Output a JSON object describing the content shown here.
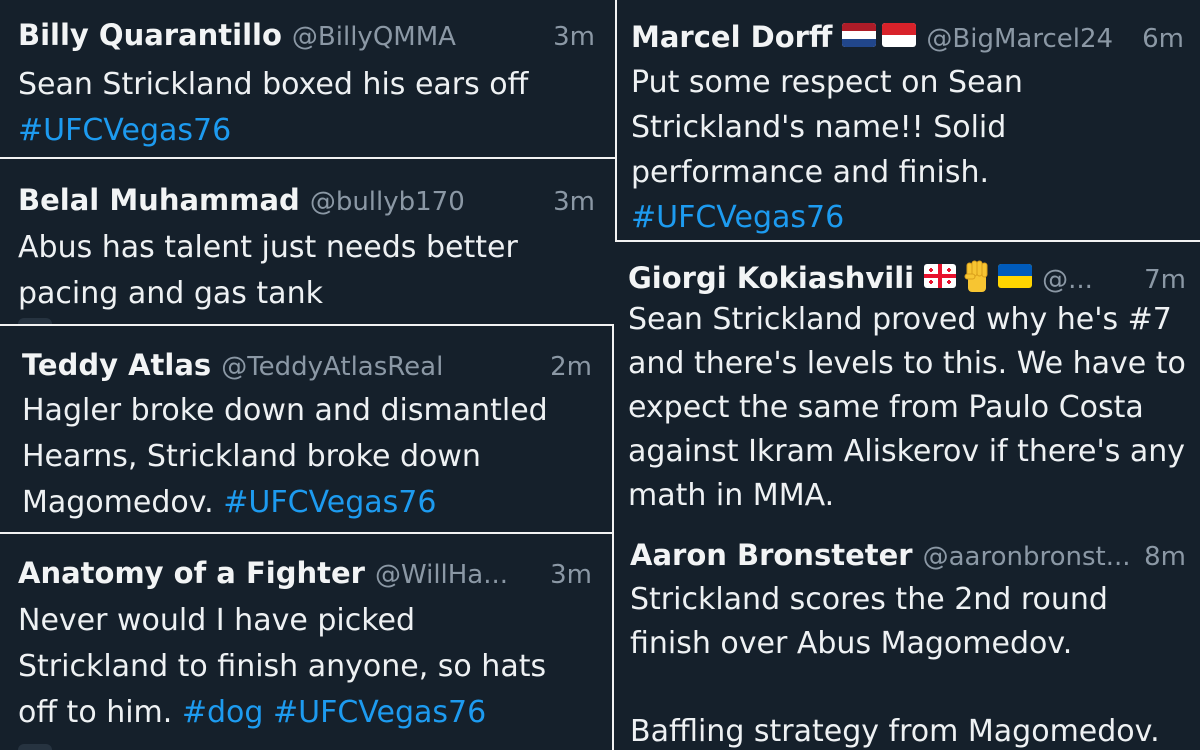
{
  "tweets": [
    {
      "name": "Billy Quarantillo",
      "handle": "@BillyQMMA",
      "time": "3m",
      "lines": [
        "Sean Strickland boxed his ears off"
      ],
      "tags_line": "#UFCVegas76"
    },
    {
      "name": "Belal Muhammad",
      "handle": "@bullyb170",
      "time": "3m",
      "lines": [
        "Abus has talent just needs better",
        "pacing and gas tank"
      ]
    },
    {
      "name": "Teddy Atlas",
      "handle": "@TeddyAtlasReal",
      "time": "2m",
      "lines": [
        "Hagler broke down and dismantled",
        "Hearns, Strickland broke down",
        "Magomedov."
      ],
      "inline_tag": "#UFCVegas76"
    },
    {
      "name": "Anatomy of a Fighter",
      "handle": "@WillHa...",
      "time": "3m",
      "lines": [
        "Never would I have picked",
        "Strickland to finish anyone, so hats",
        "off to him."
      ],
      "inline_tags": [
        "#dog",
        "#UFCVegas76"
      ]
    },
    {
      "name": "Marcel Dorff",
      "flags": [
        "netherlands-flag-icon",
        "indonesia-flag-icon"
      ],
      "handle": "@BigMarcel24",
      "time": "6m",
      "lines": [
        "Put some respect on Sean",
        "Strickland's name!! Solid",
        "performance and finish."
      ],
      "tags_line": "#UFCVegas76"
    },
    {
      "name": "Giorgi Kokiashvili",
      "flags": [
        "georgia-flag-icon",
        "raised-fist-icon",
        "ukraine-flag-icon"
      ],
      "handle": "@...",
      "time": "7m",
      "lines": [
        "Sean Strickland proved why he's #7",
        "and there's levels to this. We have to",
        "expect the same from Paulo Costa",
        "against Ikram Aliskerov if there's any",
        "math in MMA."
      ]
    },
    {
      "name": "Aaron Bronsteter",
      "handle": "@aaronbronst...",
      "time": "8m",
      "lines": [
        "Strickland scores the 2nd round",
        "finish over Abus Magomedov."
      ],
      "extra_line": "Baffling strategy from Magomedov."
    }
  ],
  "colors": {
    "background": "#15202b",
    "text": "#eef1f3",
    "muted": "#8b98a5",
    "hashtag": "#1d9bf0",
    "gap": "#f2f2f2"
  }
}
